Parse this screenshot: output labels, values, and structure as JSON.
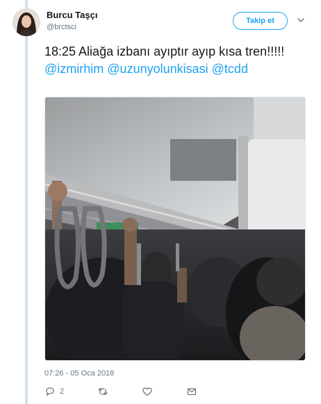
{
  "author": {
    "name": "Burcu Taşçı",
    "handle": "@brctsci"
  },
  "follow_button": {
    "label": "Takip et"
  },
  "tweet": {
    "text_prefix": "18:25 Aliağa izbanı ayıptır ayıp kısa tren!!!!!",
    "mentions": [
      "@izmirhim",
      "@uzunyolunkisasi",
      "@tcdd"
    ]
  },
  "timestamp": "07:26 - 05 Oca 2018",
  "stats": {
    "reply_count": "2"
  },
  "icons": {
    "reply": "reply-icon",
    "retweet": "retweet-icon",
    "like": "heart-icon",
    "more": "chevron-down-icon"
  },
  "colors": {
    "accent": "#1da1f2",
    "text": "#14171a",
    "muted": "#657786",
    "thread_line": "#cfe3f1"
  }
}
